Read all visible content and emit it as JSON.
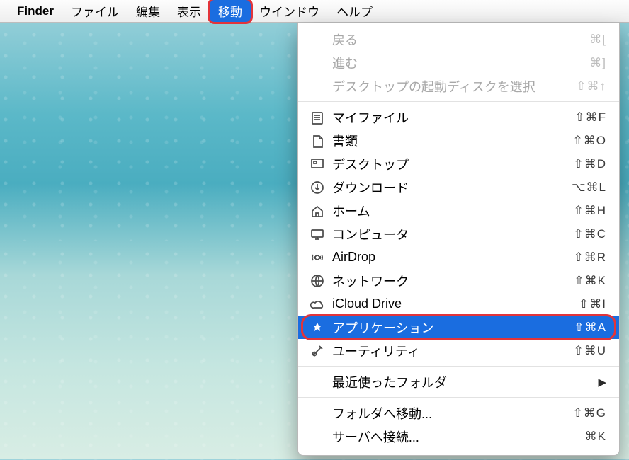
{
  "menubar": {
    "app": "Finder",
    "items": [
      {
        "label": "ファイル",
        "active": false
      },
      {
        "label": "編集",
        "active": false
      },
      {
        "label": "表示",
        "active": false
      },
      {
        "label": "移動",
        "active": true,
        "highlight": true
      },
      {
        "label": "ウインドウ",
        "active": false
      },
      {
        "label": "ヘルプ",
        "active": false
      }
    ]
  },
  "dropdown": {
    "groups": [
      [
        {
          "label": "戻る",
          "shortcut": "⌘[",
          "icon": "",
          "disabled": true
        },
        {
          "label": "進む",
          "shortcut": "⌘]",
          "icon": "",
          "disabled": true
        },
        {
          "label": "デスクトップの起動ディスクを選択",
          "shortcut": "⇧⌘↑",
          "icon": "",
          "disabled": true
        }
      ],
      [
        {
          "label": "マイファイル",
          "shortcut": "⇧⌘F",
          "icon": "file"
        },
        {
          "label": "書類",
          "shortcut": "⇧⌘O",
          "icon": "doc"
        },
        {
          "label": "デスクトップ",
          "shortcut": "⇧⌘D",
          "icon": "desktop"
        },
        {
          "label": "ダウンロード",
          "shortcut": "⌥⌘L",
          "icon": "download"
        },
        {
          "label": "ホーム",
          "shortcut": "⇧⌘H",
          "icon": "home"
        },
        {
          "label": "コンピュータ",
          "shortcut": "⇧⌘C",
          "icon": "computer"
        },
        {
          "label": "AirDrop",
          "shortcut": "⇧⌘R",
          "icon": "airdrop"
        },
        {
          "label": "ネットワーク",
          "shortcut": "⇧⌘K",
          "icon": "network"
        },
        {
          "label": "iCloud Drive",
          "shortcut": "⇧⌘I",
          "icon": "cloud"
        },
        {
          "label": "アプリケーション",
          "shortcut": "⇧⌘A",
          "icon": "apps",
          "selected": true,
          "highlight": true
        },
        {
          "label": "ユーティリティ",
          "shortcut": "⇧⌘U",
          "icon": "util"
        }
      ],
      [
        {
          "label": "最近使ったフォルダ",
          "shortcut": "",
          "icon": "",
          "submenu": true
        }
      ],
      [
        {
          "label": "フォルダへ移動...",
          "shortcut": "⇧⌘G",
          "icon": ""
        },
        {
          "label": "サーバへ接続...",
          "shortcut": "⌘K",
          "icon": ""
        }
      ]
    ]
  }
}
